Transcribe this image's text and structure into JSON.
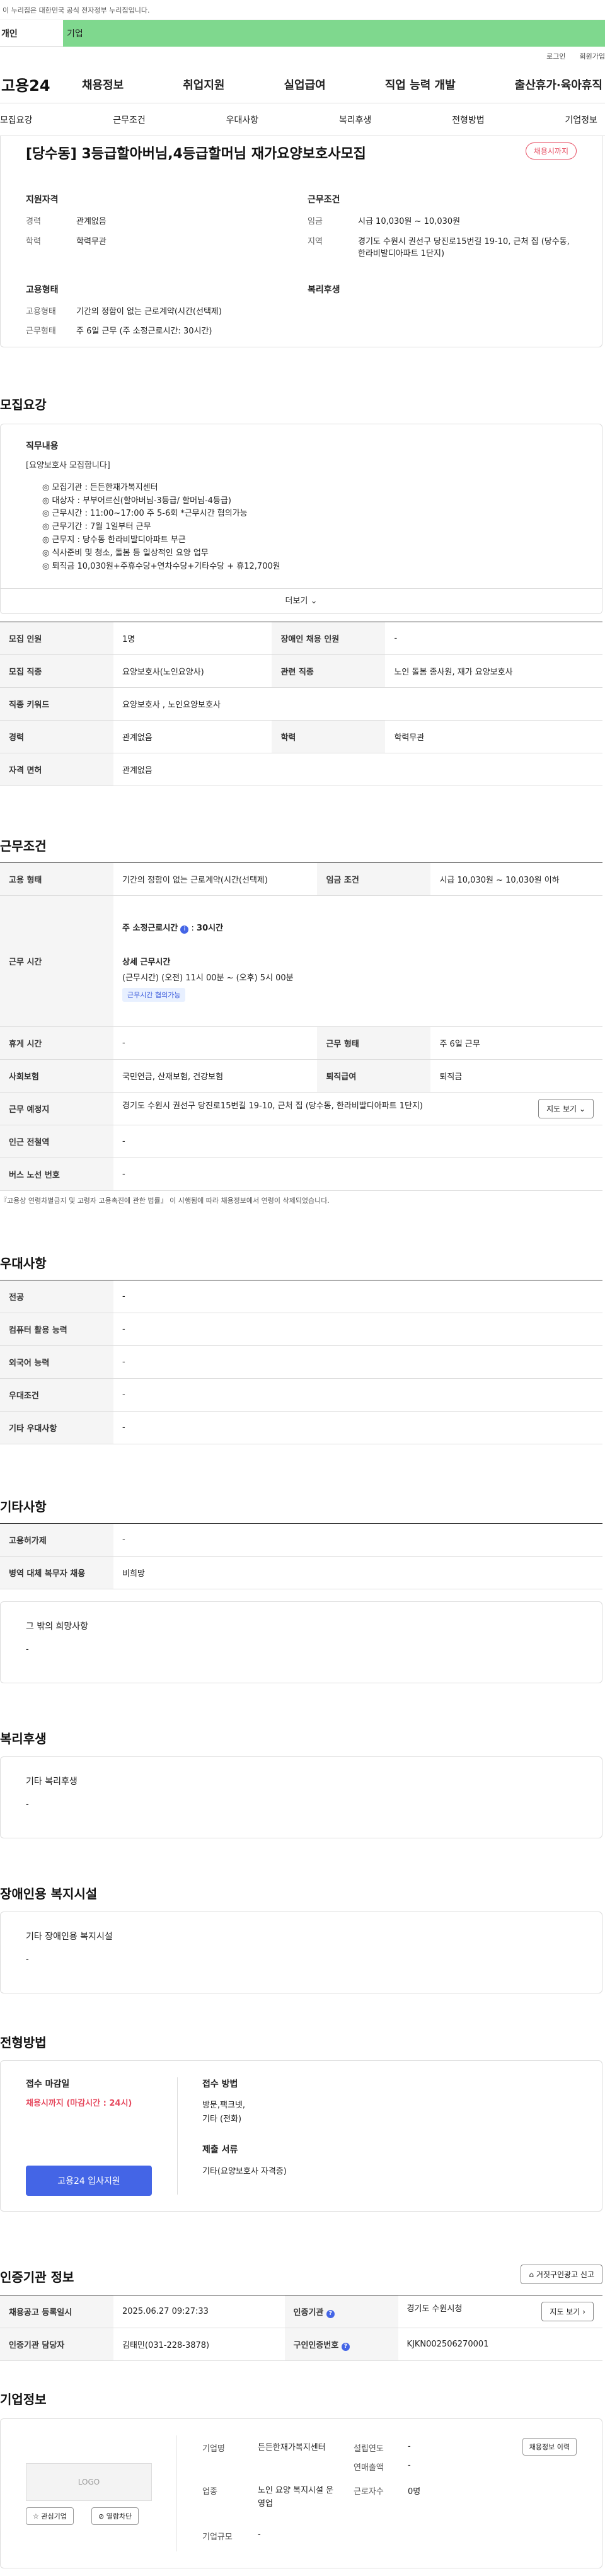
{
  "gov_banner": "이 누리집은 대한민국 공식 전자정부 누리집입니다.",
  "tabs": [
    "개인",
    "기업"
  ],
  "util": {
    "login": "로그인",
    "signup": "회원가입"
  },
  "logo": "고용24",
  "gnb": [
    "채용정보",
    "취업지원",
    "실업급여",
    "직업 능력 개발",
    "출산휴가·육아휴직"
  ],
  "subnav": [
    "모집요강",
    "근무조건",
    "우대사항",
    "복리후생",
    "전형방법",
    "기업정보"
  ],
  "job": {
    "title": "[당수동] 3등급할아버님,4등급할머님 재가요양보호사모집",
    "badge": "채용시까지",
    "qual_heading": "지원자격",
    "career_k": "경력",
    "career_v": "관계없음",
    "edu_k": "학력",
    "edu_v": "학력무관",
    "cond_heading": "근무조건",
    "wage_k": "임금",
    "wage_v": "시급 10,030원 ~ 10,030원",
    "region_k": "지역",
    "region_v": "경기도 수원시 권선구 당진로15번길 19-10, 근처 집 (당수동, 한라비발디아파트 1단지)",
    "emp_heading": "고용형태",
    "emptype_k": "고용형태",
    "emptype_v": "기간의 정함이 없는 근로계약(시간(선택제)",
    "workform_k": "근무형태",
    "workform_v": "주 6일 근무 (주 소정근로시간: 30시간)",
    "welfare_heading": "복리후생"
  },
  "recruit": {
    "title": "모집요강",
    "desc_heading": "직무내용",
    "desc_intro": "[요양보호사 모집합니다]",
    "desc_lines": [
      "◎ 모집기관 : 든든한재가복지센터",
      "◎ 대상자 : 부부어르신(할아버님-3등급/ 할머님-4등급)",
      "◎ 근무시간 : 11:00~17:00 주 5-6회 *근무시간 협의가능",
      "◎ 근무기간 : 7월 1일부터 근무",
      "◎ 근무지 : 당수동 한라비발디아파트 부근",
      "◎ 식사준비 및 청소, 돌봄 등 일상적인 요양 업무",
      "◎ 퇴직금 10,030원+주휴수당+연차수당+기타수당 + 휴12,700원"
    ],
    "more": "더보기",
    "rows": [
      {
        "k1": "모집 인원",
        "v1": "1명",
        "k2": "장애인 채용 인원",
        "v2": "-"
      },
      {
        "k1": "모집 직종",
        "v1": "요양보호사(노인요양사)",
        "k2": "관련 직종",
        "v2": "노인 돌봄 종사원, 재가 요양보호사"
      },
      {
        "k1": "직종 키워드",
        "v1": "요양보호사 , 노인요양보호사"
      },
      {
        "k1": "경력",
        "v1": "관계없음",
        "k2": "학력",
        "v2": "학력무관"
      },
      {
        "k1": "자격 면허",
        "v1": "관계없음"
      }
    ]
  },
  "conditions": {
    "title": "근무조건",
    "emp_k": "고용 형태",
    "emp_v": "기간의 정함이 없는 근로계약(시간(선택제)",
    "wage_k": "임금 조건",
    "wage_v": "시급 10,030원 ~ 10,030원 이하",
    "time_k": "근무 시간",
    "weekly": "주 소정근로시간",
    "weekly_v": "30시간",
    "detail_h": "상세 근무시간",
    "detail_v": "(근무시간) (오전) 11시 00분 ~ (오후) 5시 00분",
    "tag": "근무시간 협의가능",
    "rest_k": "휴게 시간",
    "rest_v": "-",
    "form_k": "근무 형태",
    "form_v": "주 6일 근무",
    "ins_k": "사회보험",
    "ins_v": "국민연금, 산재보험, 건강보험",
    "sev_k": "퇴직급여",
    "sev_v": "퇴직금",
    "place_k": "근무 예정지",
    "place_v": "경기도 수원시 권선구 당진로15번길 19-10, 근처 집 (당수동, 한라비발디아파트 1단지)",
    "map_btn": "지도 보기",
    "subway_k": "인근 전철역",
    "subway_v": "-",
    "bus_k": "버스 노선 번호",
    "bus_v": "-",
    "note": "『고용상 연령차별금지 및 고령자 고용촉진에 관한 법률』 이 시행됨에 따라 채용정보에서 연령이 삭제되었습니다."
  },
  "preference": {
    "title": "우대사항",
    "rows": [
      {
        "k": "전공",
        "v": "-"
      },
      {
        "k": "컴퓨터 활용 능력",
        "v": "-"
      },
      {
        "k": "외국어 능력",
        "v": "-"
      },
      {
        "k": "우대조건",
        "v": "-"
      },
      {
        "k": "기타 우대사항",
        "v": "-"
      }
    ]
  },
  "etc": {
    "title": "기타사항",
    "rows": [
      {
        "k": "고용허가제",
        "v": "-"
      },
      {
        "k": "병역 대체 복무자 채용",
        "v": "비희망"
      }
    ],
    "card_h": "그 밖의 희망사항",
    "card_v": "-"
  },
  "welfare": {
    "title": "복리후생",
    "card_h": "기타 복리후생",
    "card_v": "-"
  },
  "disability": {
    "title": "장애인용 복지시설",
    "card_h": "기타 장애인용 복지시설",
    "card_v": "-"
  },
  "process": {
    "title": "전형방법",
    "deadline_h": "접수 마감일",
    "deadline_v": "채용시까지 (마감시간 : 24시)",
    "apply_btn": "고용24 입사지원",
    "method_h": "접수 방법",
    "method_v1": "방문,팩크넷,",
    "method_v2": "기타 (전화)",
    "docs_h": "제출 서류",
    "docs_v": "기타(요양보호사 자격증)"
  },
  "cert": {
    "title": "인증기관 정보",
    "report_btn": "거짓구인광고 신고",
    "reg_k": "채용공고 등록일시",
    "reg_v": "2025.06.27 09:27:33",
    "org_k": "인증기관",
    "org_v": "경기도 수원시청",
    "map_btn": "지도 보기",
    "mgr_k": "인증기관 담당자",
    "mgr_v": "김태민(031-228-3878)",
    "num_k": "구인인증번호",
    "num_v": "KJKN002506270001"
  },
  "company": {
    "title": "기업정보",
    "logo": "LOGO",
    "fav_btn": "관심기업",
    "block_btn": "열람차단",
    "list_btn": "채용정보 이력",
    "name_k": "기업명",
    "name_v": "든든한재가복지센터",
    "est_k": "설립연도",
    "est_v": "-",
    "sales_k": "연매출액",
    "sales_v": "-",
    "ind_k": "업종",
    "ind_v": "노인 요양 복지시설 운영업",
    "emp_k": "근로자수",
    "emp_v": "0명",
    "size_k": "기업규모",
    "size_v": "-"
  },
  "colors": {
    "accent_green": "#7fd88e",
    "badge_red": "#e6495e",
    "apply_blue": "#4465e6"
  }
}
